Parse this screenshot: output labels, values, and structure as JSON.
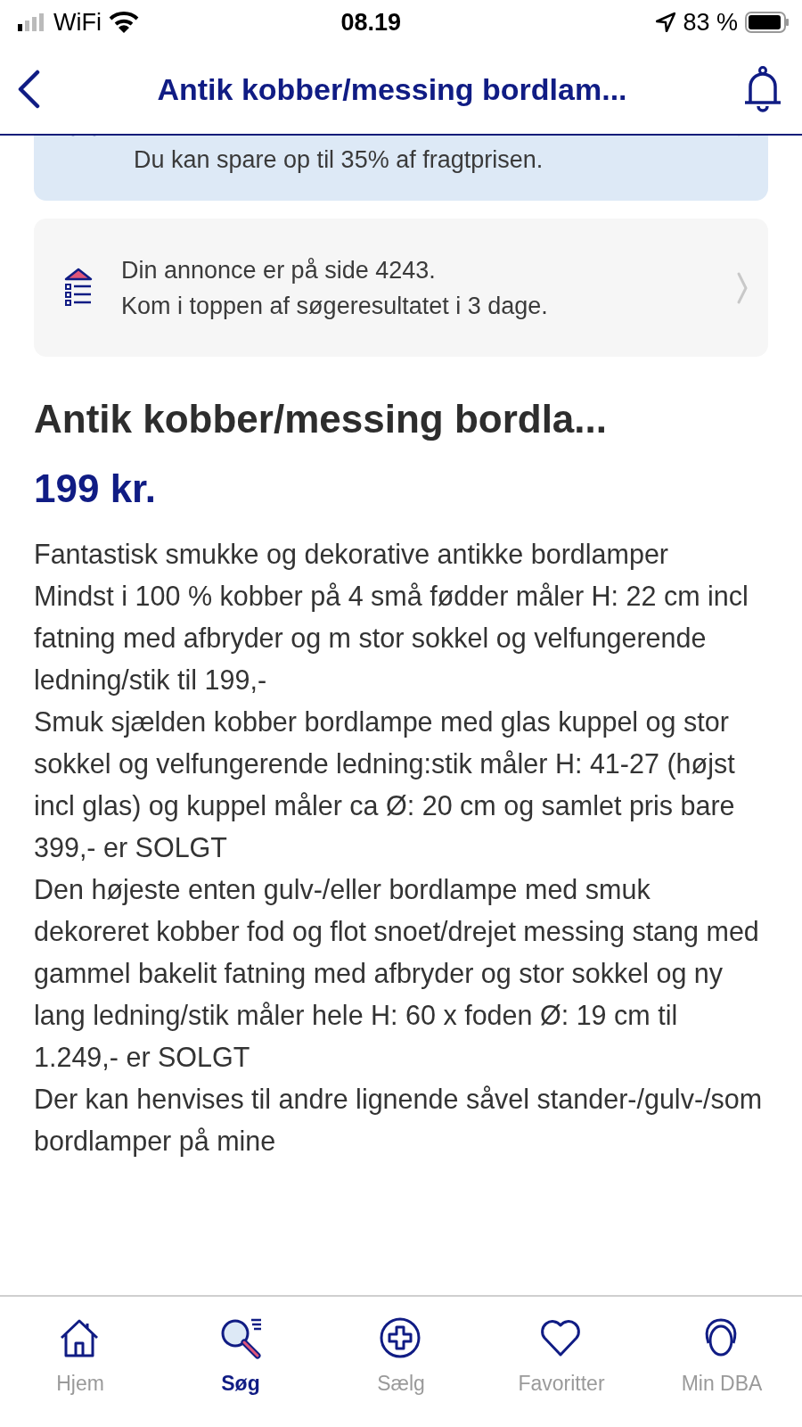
{
  "status_bar": {
    "carrier": "WiFi",
    "time": "08.19",
    "battery": "83 %"
  },
  "nav": {
    "title": "Antik kobber/messing bordlam..."
  },
  "notices": [
    {
      "kind": "shipping",
      "lines": [
        "Du kan spare op til 35% af fragtprisen."
      ]
    },
    {
      "kind": "ranking",
      "lines": [
        "Din annonce er på side 4243.",
        "Kom i toppen af søgeresultatet i 3 dage."
      ]
    }
  ],
  "listing": {
    "title": "Antik kobber/messing bordla...",
    "price": "199 kr.",
    "description": [
      "Fantastisk smukke og dekorative antikke bordlamper",
      "Mindst i 100 % kobber på 4 små fødder måler H: 22 cm incl fatning med afbryder og m stor sokkel og velfungerende ledning/stik til 199,-",
      "Smuk sjælden kobber bordlampe med glas kuppel og stor sokkel og velfungerende ledning:stik måler H: 41-27 (højst incl glas) og kuppel måler ca Ø: 20 cm og samlet pris bare 399,- er SOLGT",
      "Den højeste enten gulv-/eller bordlampe med smuk dekoreret kobber fod og flot snoet/drejet messing stang med gammel bakelit fatning med afbryder og stor sokkel og ny lang ledning/stik måler hele H: 60 x foden Ø: 19 cm til 1.249,- er SOLGT",
      "Der kan henvises til andre lignende såvel stander-/gulv-/som bordlamper på mine"
    ]
  },
  "tab_bar": [
    {
      "kind": "home",
      "label": "Hjem",
      "selected": false
    },
    {
      "kind": "search",
      "label": "Søg",
      "selected": true
    },
    {
      "kind": "sell",
      "label": "Sælg",
      "selected": false
    },
    {
      "kind": "favorites",
      "label": "Favoritter",
      "selected": false
    },
    {
      "kind": "profile",
      "label": "Min DBA",
      "selected": false
    }
  ]
}
